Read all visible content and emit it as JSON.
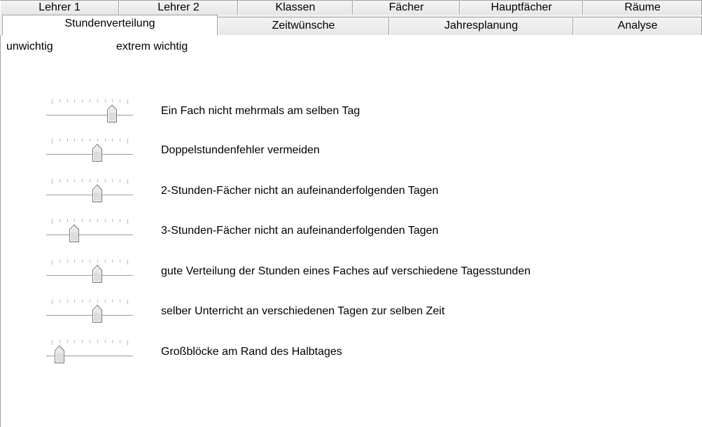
{
  "tabs_back": [
    {
      "label": "Lehrer 1"
    },
    {
      "label": "Lehrer 2"
    },
    {
      "label": "Klassen"
    },
    {
      "label": "Fächer"
    },
    {
      "label": "Hauptfächer"
    },
    {
      "label": "Räume"
    }
  ],
  "tabs_front": [
    {
      "label": "Stundenverteilung",
      "selected": true
    },
    {
      "label": "Zeitwünsche"
    },
    {
      "label": "Jahresplanung"
    },
    {
      "label": "Analyse"
    }
  ],
  "scale": {
    "low_label": "unwichtig",
    "high_label": "extrem wichtig"
  },
  "slider_steps": 10,
  "rules": [
    {
      "label": "Ein Fach nicht mehrmals am selben Tag",
      "level": 8
    },
    {
      "label": "Doppelstundenfehler vermeiden",
      "level": 6
    },
    {
      "label": "2-Stunden-Fächer nicht an aufeinanderfolgenden Tagen",
      "level": 6
    },
    {
      "label": "3-Stunden-Fächer nicht an aufeinanderfolgenden Tagen",
      "level": 3
    },
    {
      "label": "gute Verteilung der Stunden eines Faches auf verschiedene Tagesstunden",
      "level": 6
    },
    {
      "label": "selber Unterricht an verschiedenen Tagen zur selben Zeit",
      "level": 6
    },
    {
      "label": "Großblöcke am Rand des Halbtages",
      "level": 1
    }
  ]
}
